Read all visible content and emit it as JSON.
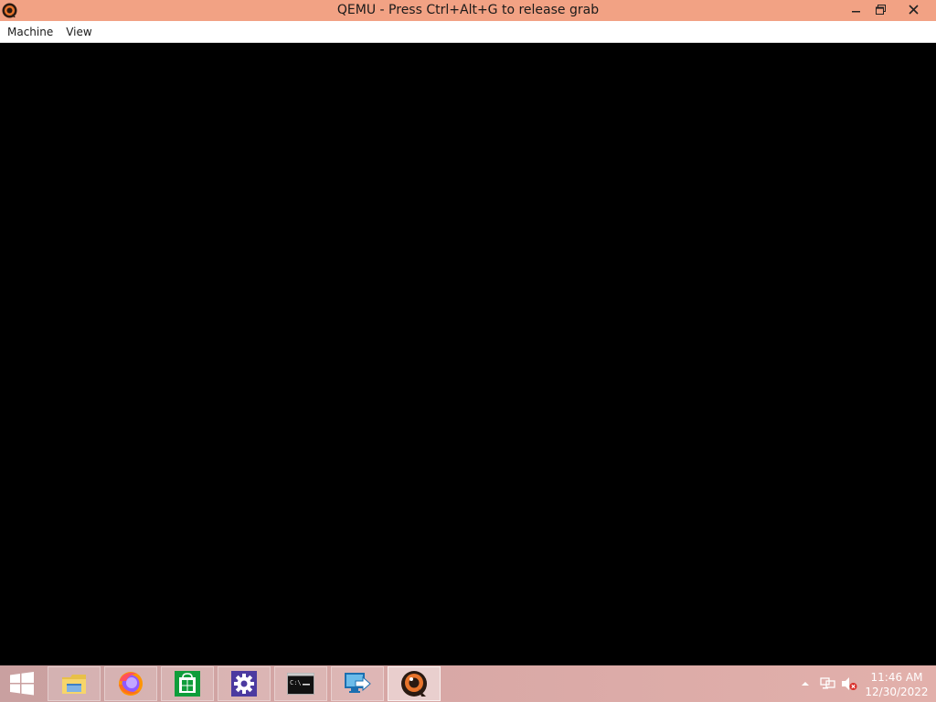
{
  "window": {
    "title": "QEMU - Press Ctrl+Alt+G to release grab",
    "app_icon": "qemu-icon",
    "controls": {
      "minimize": "–",
      "restore": "❐",
      "close": "✕"
    },
    "titlebar_color": "#f2a284"
  },
  "menubar": {
    "items": [
      {
        "label": "Machine"
      },
      {
        "label": "View"
      }
    ]
  },
  "vm_display": {
    "background": "#000000"
  },
  "taskbar": {
    "start_icon": "windows-logo-icon",
    "pinned": [
      {
        "name": "file-explorer",
        "icon": "folder-icon"
      },
      {
        "name": "firefox",
        "icon": "firefox-icon"
      },
      {
        "name": "store",
        "icon": "store-icon"
      },
      {
        "name": "settings",
        "icon": "gear-icon"
      },
      {
        "name": "command-prompt",
        "icon": "cmd-icon",
        "text": "C:\\_"
      },
      {
        "name": "remote-desktop",
        "icon": "remote-desktop-icon"
      },
      {
        "name": "qemu",
        "icon": "qemu-icon",
        "active": true
      }
    ],
    "tray": {
      "overflow_icon": "chevron-up-icon",
      "network_icon": "network-icon",
      "volume_icon": "volume-muted-icon"
    },
    "clock": {
      "time": "11:46 AM",
      "date": "12/30/2022"
    }
  }
}
